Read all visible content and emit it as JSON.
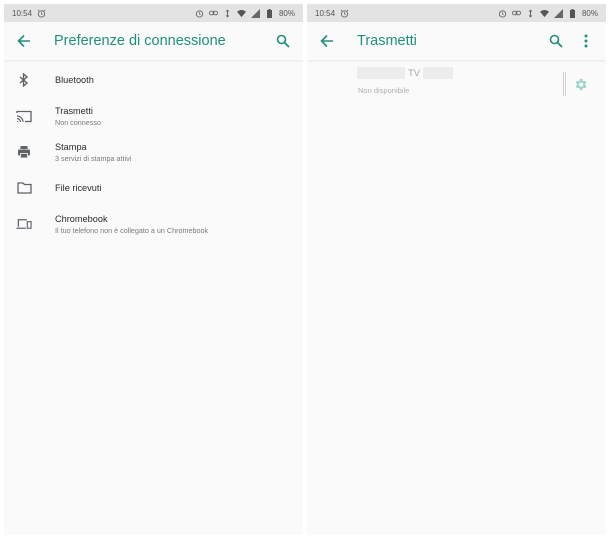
{
  "left_screen": {
    "status_bar": {
      "time": "10:54",
      "battery": "80%"
    },
    "app_bar": {
      "title": "Preferenze di connessione"
    },
    "items": [
      {
        "icon": "bluetooth-icon",
        "title": "Bluetooth",
        "subtitle": ""
      },
      {
        "icon": "cast-icon",
        "title": "Trasmetti",
        "subtitle": "Non connesso"
      },
      {
        "icon": "printer-icon",
        "title": "Stampa",
        "subtitle": "3 servizi di stampa attivi"
      },
      {
        "icon": "folder-icon",
        "title": "File ricevuti",
        "subtitle": ""
      },
      {
        "icon": "devices-icon",
        "title": "Chromebook",
        "subtitle": "Il tuo telefono non è collegato a un Chromebook"
      }
    ]
  },
  "right_screen": {
    "status_bar": {
      "time": "10:54",
      "battery": "80%"
    },
    "app_bar": {
      "title": "Trasmetti"
    },
    "device": {
      "name": "TV",
      "status": "Non disponibile"
    }
  },
  "colors": {
    "accent": "#1f8f7e",
    "icon_gray": "#5f6368",
    "gear_disabled": "#9fd3ca"
  }
}
